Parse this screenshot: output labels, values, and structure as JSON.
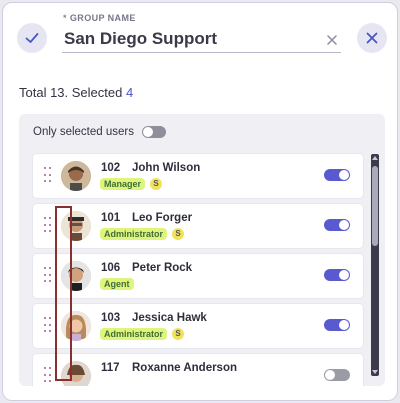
{
  "header": {
    "group_label": "GROUP NAME",
    "required_mark": "*",
    "group_name_value": "San Diego Support",
    "confirm_icon": "check-icon",
    "close_icon": "close-icon",
    "clear_icon": "clear-x-icon"
  },
  "summary": {
    "total_text": "Total 13. Selected",
    "selected_count": "4"
  },
  "filter": {
    "only_selected_label": "Only selected users",
    "only_selected_on": false
  },
  "users": [
    {
      "id": "102",
      "name": "John Wilson",
      "role": "Manager",
      "badge": "S",
      "selected": true
    },
    {
      "id": "101",
      "name": "Leo Forger",
      "role": "Administrator",
      "badge": "S",
      "selected": true
    },
    {
      "id": "106",
      "name": "Peter Rock",
      "role": "Agent",
      "badge": "",
      "selected": true
    },
    {
      "id": "103",
      "name": "Jessica Hawk",
      "role": "Administrator",
      "badge": "S",
      "selected": true
    },
    {
      "id": "117",
      "name": "Roxanne Anderson",
      "role": "",
      "badge": "",
      "selected": false
    }
  ],
  "colors": {
    "accent": "#4a55c5",
    "toggle_on": "#5a5ad0",
    "role_badge": "#dff47a",
    "s_badge": "#f0e25a",
    "highlight_border": "#8b2e2e"
  }
}
